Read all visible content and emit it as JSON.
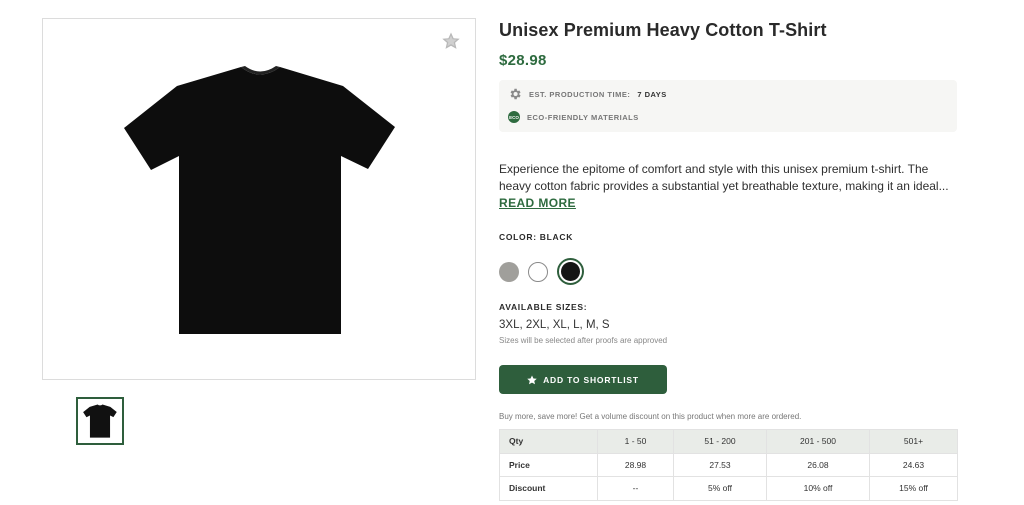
{
  "product": {
    "title": "Unisex Premium Heavy Cotton T-Shirt",
    "price": "$28.98",
    "image_alt": "black-tshirt",
    "colors": {
      "accent": "#2e5e3c",
      "price": "#2e6b3f"
    }
  },
  "info": {
    "production_label": "EST. PRODUCTION TIME:",
    "production_value": "7 DAYS",
    "eco_badge": "ECO",
    "eco_label": "ECO-FRIENDLY MATERIALS"
  },
  "description": {
    "text": "Experience the epitome of comfort and style with this unisex premium t-shirt. The heavy cotton fabric provides a substantial yet breathable texture, making it an ideal...",
    "read_more": "READ MORE"
  },
  "color": {
    "label": "COLOR: BLACK",
    "options": [
      "gray",
      "white",
      "black"
    ],
    "selected": "black"
  },
  "sizes": {
    "label": "AVAILABLE SIZES:",
    "values": "3XL, 2XL, XL, L, M, S",
    "note": "Sizes will be selected after proofs are approved"
  },
  "shortlist": {
    "label": "ADD TO SHORTLIST"
  },
  "volume": {
    "note": "Buy more, save more! Get a volume discount on this product when more are ordered.",
    "headers": [
      "Qty",
      "1 - 50",
      "51 - 200",
      "201 - 500",
      "501+"
    ],
    "price_row": [
      "Price",
      "28.98",
      "27.53",
      "26.08",
      "24.63"
    ],
    "discount_row": [
      "Discount",
      "--",
      "5% off",
      "10% off",
      "15% off"
    ]
  }
}
